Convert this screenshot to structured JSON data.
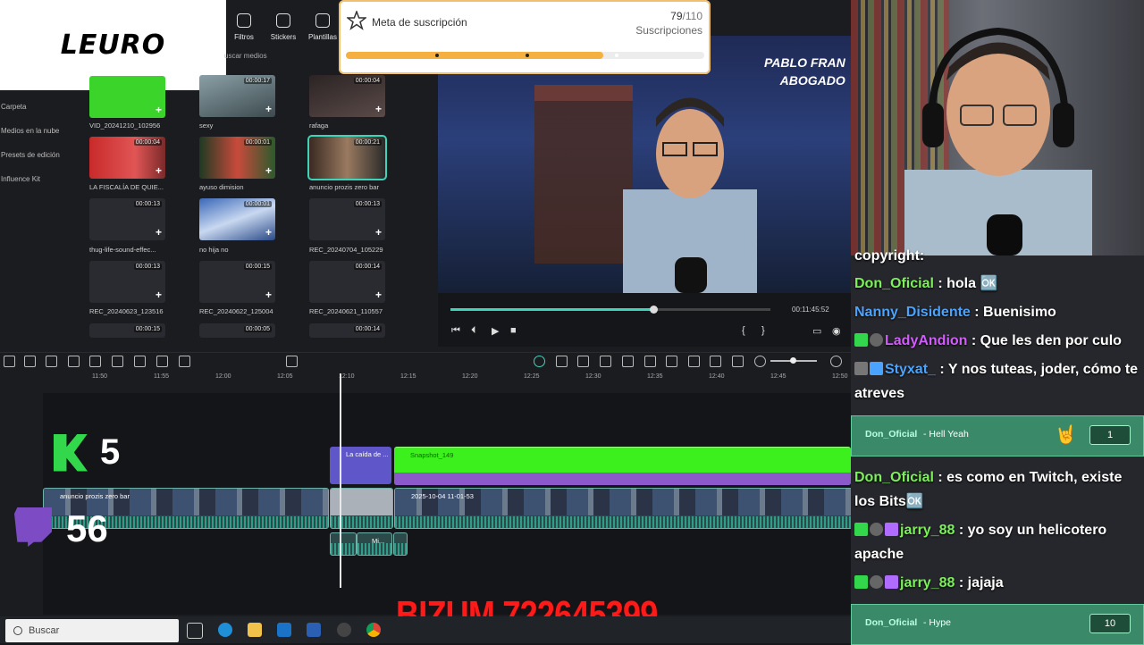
{
  "logo": {
    "text": "LEURO"
  },
  "top_tabs": [
    {
      "label": "Filtros"
    },
    {
      "label": "Stickers"
    },
    {
      "label": "Plantillas"
    }
  ],
  "search_media": "uscar medios",
  "side_nav": [
    "Carpeta",
    "Medios en la nube",
    "Presets de edición",
    "Influence Kit"
  ],
  "media": [
    {
      "name": "VID_20241210_102956",
      "duration": ""
    },
    {
      "name": "sexy",
      "duration": "00:00:17"
    },
    {
      "name": "rafaga",
      "duration": "00:00:04"
    },
    {
      "name": "LA FISCALÍA DE QUIE...",
      "duration": "00:00:04"
    },
    {
      "name": "ayuso dimision",
      "duration": "00:00:01"
    },
    {
      "name": "anuncio prozis zero bar",
      "duration": "00:00:21"
    },
    {
      "name": "thug-life-sound-effec...",
      "duration": "00:00:13"
    },
    {
      "name": "no hija no",
      "duration": "00:00:01"
    },
    {
      "name": "REC_20240704_105229",
      "duration": "00:00:13"
    },
    {
      "name": "REC_20240623_123516",
      "duration": "00:00:13"
    },
    {
      "name": "REC_20240622_125004",
      "duration": "00:00:15"
    },
    {
      "name": "REC_20240621_110557",
      "duration": "00:00:14"
    },
    {
      "name": "",
      "duration": "00:00:15"
    },
    {
      "name": "",
      "duration": "00:00:05"
    },
    {
      "name": "",
      "duration": "00:00:14"
    }
  ],
  "sub_goal": {
    "title": "Meta de suscripción",
    "current": "79",
    "target": "/110",
    "unit": "Suscripciones",
    "progress": 0.718
  },
  "preview": {
    "overlay_line1": "PABLO FRAN",
    "overlay_line2": "ABOGADO",
    "timecode": "00:11:45:52",
    "playhead": 0.635
  },
  "ruler": [
    "11:50",
    "11:55",
    "12:00",
    "12:05",
    "12:10",
    "12:15",
    "12:20",
    "12:25",
    "12:30",
    "12:35",
    "12:40",
    "12:45",
    "12:50"
  ],
  "clips": {
    "title_clip": "La caída de ...",
    "green_clip": "Snapshot_149",
    "video_clip": "2025-10-04 11-01-53",
    "prozis_clip": "anuncio prozis zero bar",
    "small_clip": "Mi..."
  },
  "overlays": {
    "kick_count": "5",
    "twitch_count": "56",
    "bizum": "BIZUM 722645399"
  },
  "taskbar": {
    "search": "Buscar"
  },
  "chat": [
    {
      "user": "",
      "text": "copyright:",
      "color": "#ffffff"
    },
    {
      "user": "Don_Oficial",
      "text": ": hola 🆗",
      "color": "#7cf05a"
    },
    {
      "user": "Nanny_Disidente",
      "text": ": Buenisimo",
      "color": "#4aa3ff"
    },
    {
      "user": "LadyAndion",
      "text": ": Que les den por culo",
      "color": "#d35cff"
    },
    {
      "user": "Styxat_",
      "text": ": Y nos tuteas, joder, cómo te atreves",
      "color": "#4aa3ff"
    },
    {
      "user": "Don_Oficial",
      "text": ": es como en Twitch, existe los Bits🆗",
      "color": "#7cf05a"
    },
    {
      "user": "jarry_88",
      "text": ": yo soy un helicotero apache",
      "color": "#7cf05a"
    },
    {
      "user": "jarry_88",
      "text": ": jajaja",
      "color": "#7cf05a"
    }
  ],
  "highlights": [
    {
      "user": "Don_Oficial",
      "msg": "- Hell Yeah",
      "count": "1"
    },
    {
      "user": "Don_Oficial",
      "msg": "- Hype",
      "count": "10"
    }
  ],
  "colors": {
    "accent": "#3fd3b8",
    "goal_fill": "#f5b041",
    "bizum": "#ff1a1a",
    "kick": "#32d74b",
    "twitch": "#7d4cc4"
  }
}
